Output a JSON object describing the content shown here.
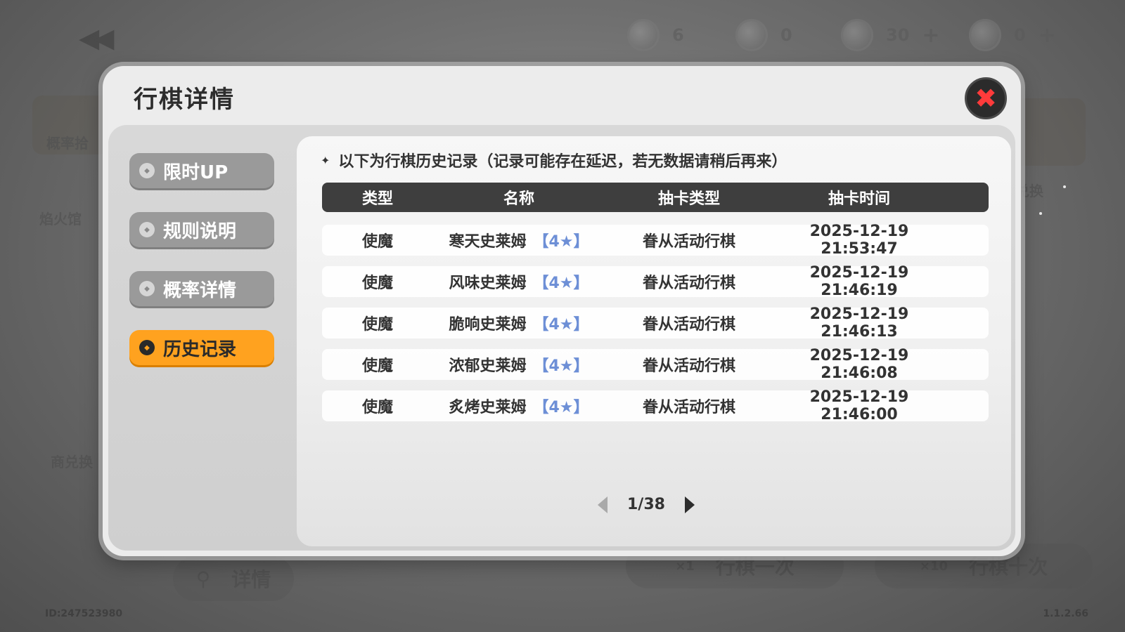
{
  "background": {
    "resources": [
      {
        "icon": "dice-coin-icon",
        "value": "6",
        "has_plus": false
      },
      {
        "icon": "fruit-coin-icon",
        "value": "0",
        "has_plus": false
      },
      {
        "icon": "gem-coin-icon",
        "value": "30",
        "has_plus": true
      },
      {
        "icon": "crown-coin-icon",
        "value": "0",
        "has_plus": true
      }
    ],
    "left_label": "概率拾",
    "left_label_2": "焰火馆",
    "right_label": "资兑换",
    "shop_label": "商兑换",
    "detail_button": "详情",
    "once_button": {
      "cost": "×1",
      "label": "行棋一次"
    },
    "ten_button": {
      "cost": "×10",
      "label": "行棋十次"
    },
    "user_id": "ID:247523980",
    "version": "1.1.2.66"
  },
  "dialog": {
    "title": "行棋详情",
    "close_icon": "close-icon",
    "sidebar": [
      {
        "label": "限时UP",
        "active": false
      },
      {
        "label": "规则说明",
        "active": false
      },
      {
        "label": "概率详情",
        "active": false
      },
      {
        "label": "历史记录",
        "active": true
      }
    ],
    "notice": "以下为行棋历史记录（记录可能存在延迟，若无数据请稍后再来）",
    "table": {
      "columns": [
        "类型",
        "名称",
        "抽卡类型",
        "抽卡时间"
      ],
      "rows": [
        {
          "type": "使魔",
          "name": "寒天史莱姆",
          "rarity": "【4★】",
          "draw_type": "眷从活动行棋",
          "time": "2025-12-19 21:53:47"
        },
        {
          "type": "使魔",
          "name": "风味史莱姆",
          "rarity": "【4★】",
          "draw_type": "眷从活动行棋",
          "time": "2025-12-19 21:46:19"
        },
        {
          "type": "使魔",
          "name": "脆响史莱姆",
          "rarity": "【4★】",
          "draw_type": "眷从活动行棋",
          "time": "2025-12-19 21:46:13"
        },
        {
          "type": "使魔",
          "name": "浓郁史莱姆",
          "rarity": "【4★】",
          "draw_type": "眷从活动行棋",
          "time": "2025-12-19 21:46:08"
        },
        {
          "type": "使魔",
          "name": "炙烤史莱姆",
          "rarity": "【4★】",
          "draw_type": "眷从活动行棋",
          "time": "2025-12-19 21:46:00"
        }
      ]
    },
    "pagination": {
      "page": "1/38"
    }
  },
  "colors": {
    "accent": "#ffa21f",
    "rarity": "#6d8fd6",
    "close": "#ff3b3b",
    "header": "#3e3e3e"
  }
}
